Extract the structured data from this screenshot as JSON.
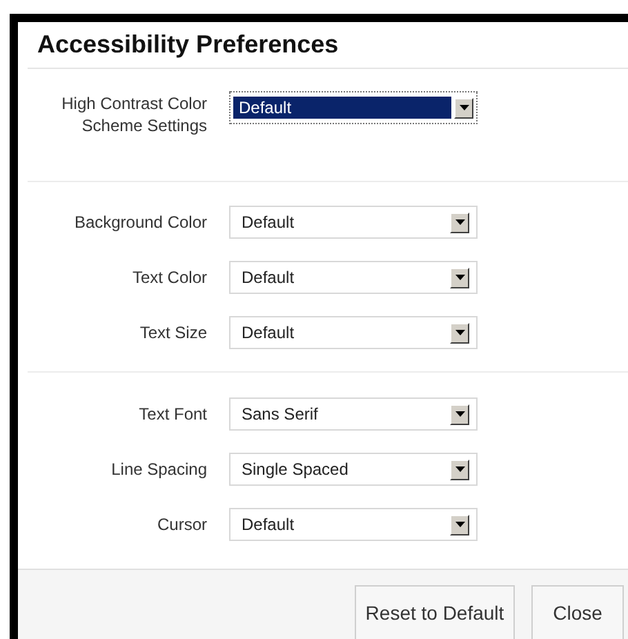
{
  "dialog": {
    "title": "Accessibility Preferences"
  },
  "sections": [
    {
      "rows": [
        {
          "label": "High Contrast Color Scheme Settings",
          "value": "Default",
          "focused": true
        }
      ]
    },
    {
      "rows": [
        {
          "label": "Background Color",
          "value": "Default",
          "focused": false
        },
        {
          "label": "Text Color",
          "value": "Default",
          "focused": false
        },
        {
          "label": "Text Size",
          "value": "Default",
          "focused": false
        }
      ]
    },
    {
      "rows": [
        {
          "label": "Text Font",
          "value": "Sans Serif",
          "focused": false
        },
        {
          "label": "Line Spacing",
          "value": "Single Spaced",
          "focused": false
        },
        {
          "label": "Cursor",
          "value": "Default",
          "focused": false
        }
      ]
    }
  ],
  "buttons": [
    "Reset to Default",
    "Close"
  ]
}
